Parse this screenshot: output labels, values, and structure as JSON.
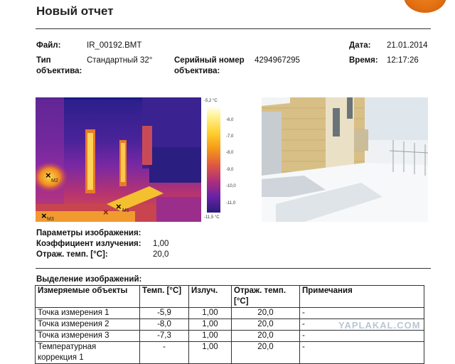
{
  "report": {
    "title": "Новый отчет"
  },
  "info": {
    "file_label": "Файл:",
    "file_value": "IR_00192.BMT",
    "lens_label_1": "Тип",
    "lens_label_2": "объектива:",
    "lens_value": "Стандартный 32°",
    "serial_label_1": "Серийный номер",
    "serial_label_2": "объектива:",
    "serial_value": "4294967295",
    "date_label": "Дата:",
    "date_value": "21.01.2014",
    "time_label": "Время:",
    "time_value": "12:17:26"
  },
  "scale": {
    "top": "-5,2 °C",
    "bottom": "-11,5 °C",
    "ticks": [
      "-6,0",
      "-7,0",
      "-8,0",
      "-9,0",
      "-10,0",
      "-11,0"
    ]
  },
  "markers": {
    "m1": "M1",
    "m2": "M2",
    "m3": "M3",
    "x": "×"
  },
  "params": {
    "heading": "Параметры изображения:",
    "emissivity_label": "Коэффициент излучения:",
    "emissivity_value": "1,00",
    "refl_label": "Отраж. темп. [°C]:",
    "refl_value": "20,0"
  },
  "selection": {
    "heading": "Выделение изображений:",
    "columns": [
      "Измеряемые объекты",
      "Темп. [°C]",
      "Излуч.",
      "Отраж. темп. [°C]",
      "Примечания"
    ],
    "rows": [
      [
        "Точка измерения 1",
        "-5,9",
        "1,00",
        "20,0",
        "-"
      ],
      [
        "Точка измерения 2",
        "-8,0",
        "1,00",
        "20,0",
        "-"
      ],
      [
        "Точка измерения 3",
        "-7,3",
        "1,00",
        "20,0",
        "-"
      ],
      [
        "Температурная",
        "-",
        "1,00",
        "20,0",
        "-"
      ]
    ],
    "row4_line2": "коррекция 1"
  },
  "watermark": "YAPLAKAL.COM"
}
